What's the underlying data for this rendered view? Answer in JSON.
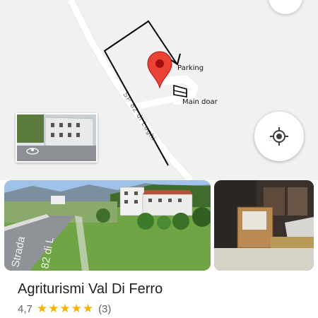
{
  "map": {
    "annotations": {
      "parking": "Parking",
      "main_door": "Main doar"
    },
    "road_label": "SP 82 di Lughi",
    "marker_color": "#ea4335",
    "icons": [
      "compass-icon",
      "my-location-icon",
      "place-marker-icon",
      "street-view-icon"
    ]
  },
  "photos": {
    "main_road_text": [
      "Strada",
      "82 di L"
    ]
  },
  "place": {
    "name": "Agriturismi Val Di Ferro",
    "rating": "4,7",
    "stars_glyph": "★★★★★",
    "review_count": "(3)"
  }
}
